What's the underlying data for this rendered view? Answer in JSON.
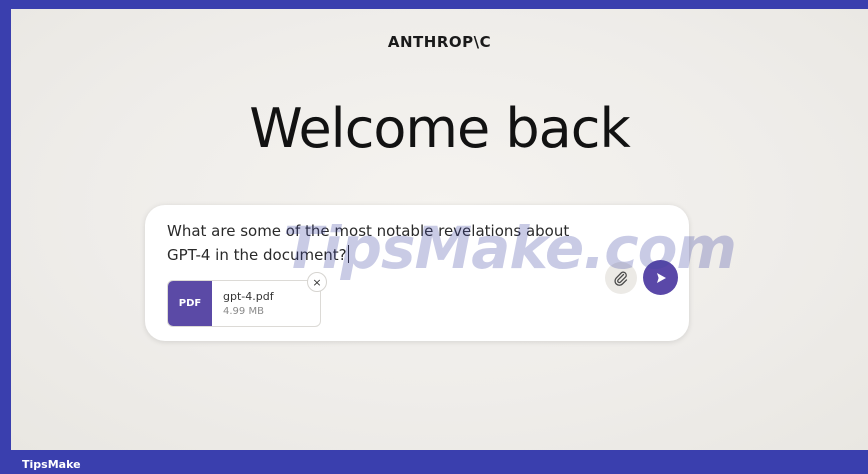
{
  "header": {
    "logo": "ANTHROP\\C"
  },
  "main": {
    "title": "Welcome back"
  },
  "composer": {
    "prompt_text": "What are some of the most notable revelations about GPT-4 in the document?",
    "attachment": {
      "type_label": "PDF",
      "file_name": "gpt-4.pdf",
      "file_size": "4.99 MB"
    },
    "remove_symbol": "×",
    "accent_color": "#5a48a8"
  },
  "watermark": {
    "text": "TipsMake.com"
  },
  "footer": {
    "label": "TipsMake",
    "bar_color": "#3a3fae"
  },
  "icons": [
    "paperclip-icon",
    "send-arrow-icon",
    "close-icon"
  ]
}
